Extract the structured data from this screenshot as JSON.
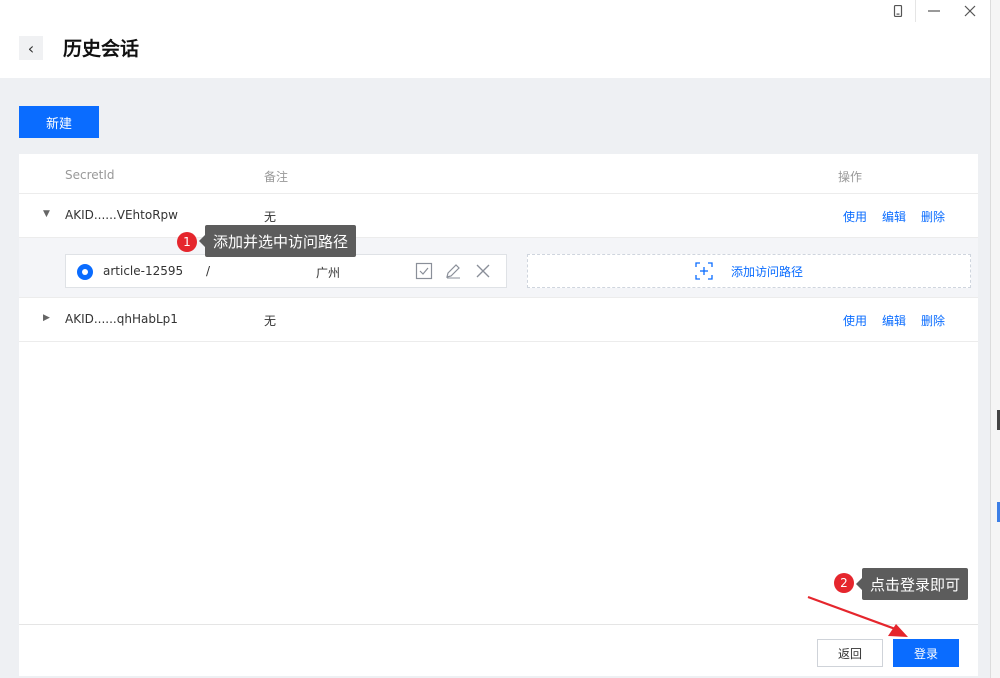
{
  "header": {
    "title": "历史会话"
  },
  "toolbar": {
    "new_label": "新建"
  },
  "table": {
    "columns": {
      "secret_id": "SecretId",
      "note": "备注",
      "actions": "操作"
    },
    "rows": [
      {
        "secret_id": "AKID......VEhtoRpw",
        "note": "无",
        "expanded": true,
        "actions": {
          "use": "使用",
          "edit": "编辑",
          "delete": "删除"
        }
      },
      {
        "secret_id": "AKID......qhHabLp1",
        "note": "无",
        "expanded": false,
        "actions": {
          "use": "使用",
          "edit": "编辑",
          "delete": "删除"
        }
      }
    ]
  },
  "path_entry": {
    "name": "article-12595",
    "path": "/",
    "region": "广州",
    "selected": true
  },
  "add_path": {
    "label": "添加访问路径"
  },
  "footer": {
    "back_label": "返回",
    "login_label": "登录"
  },
  "annotations": [
    {
      "num": "1",
      "text": "添加并选中访问路径"
    },
    {
      "num": "2",
      "text": "点击登录即可"
    }
  ],
  "colors": {
    "primary": "#0a6cff",
    "annotation_badge": "#e5262d",
    "annotation_box": "#5c5c5c",
    "arrow": "#e5262d"
  }
}
